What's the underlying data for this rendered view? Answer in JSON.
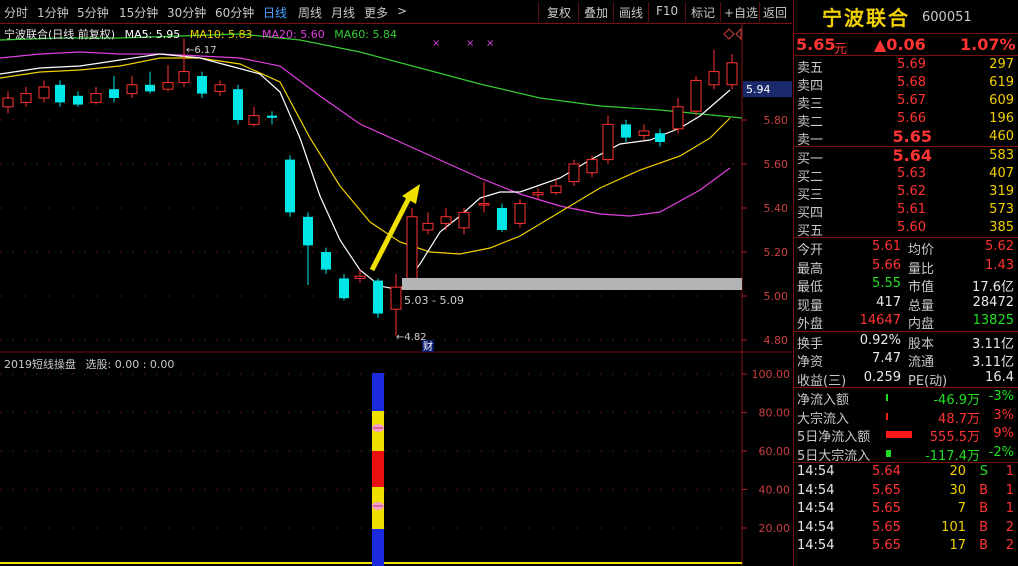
{
  "toolbar": {
    "period_tabs": [
      "分时",
      "1分钟",
      "5分钟",
      "15分钟",
      "30分钟",
      "60分钟",
      "日线",
      "周线",
      "月线",
      "更多"
    ],
    "more_arrow": ">",
    "active_tab": "日线",
    "actions": [
      "复权",
      "叠加",
      "画线",
      "F10",
      "标记",
      "+自选",
      "返回"
    ]
  },
  "chart": {
    "title": "宁波联合(日线 前复权)",
    "ma": [
      {
        "label": "MA5: 5.95",
        "color": "#ffffff"
      },
      {
        "label": "MA10: 5.83",
        "color": "#f0d000"
      },
      {
        "label": "MA20: 5.60",
        "color": "#e040e0"
      },
      {
        "label": "MA60: 5.84",
        "color": "#33cc33"
      }
    ],
    "price_axis": [
      "5.80",
      "5.60",
      "5.40",
      "5.20",
      "5.00",
      "4.80"
    ],
    "current_price_tag": "5.94",
    "high_mark": "6.17",
    "low_mark": "4.82",
    "range_label": "5.03 - 5.09",
    "finance_marker": "财",
    "sub_title": "2019短线操盘",
    "sub_select": "选股: 0.00 : 0.00",
    "sub_axis": [
      "100.00",
      "80.00",
      "60.00",
      "40.00",
      "20.00"
    ],
    "colors": {
      "up": "#ff3333",
      "down": "#00e5e5",
      "ma5": "#ffffff",
      "ma10": "#f0d000",
      "ma20": "#e040e0",
      "ma60": "#33cc33",
      "arrow": "#f0e000",
      "band": "#b4b4b4"
    }
  },
  "panel": {
    "name": "宁波联合",
    "code": "600051",
    "price": "5.65",
    "price_unit": "元",
    "change": "▲0.06",
    "change_pct": "1.07%",
    "asks": [
      {
        "label": "卖五",
        "price": "5.69",
        "vol": "297"
      },
      {
        "label": "卖四",
        "price": "5.68",
        "vol": "619"
      },
      {
        "label": "卖三",
        "price": "5.67",
        "vol": "609"
      },
      {
        "label": "卖二",
        "price": "5.66",
        "vol": "196"
      },
      {
        "label": "卖一",
        "price": "5.65",
        "vol": "460"
      }
    ],
    "bids": [
      {
        "label": "买一",
        "price": "5.64",
        "vol": "583"
      },
      {
        "label": "买二",
        "price": "5.63",
        "vol": "407"
      },
      {
        "label": "买三",
        "price": "5.62",
        "vol": "319"
      },
      {
        "label": "买四",
        "price": "5.61",
        "vol": "573"
      },
      {
        "label": "买五",
        "price": "5.60",
        "vol": "385"
      }
    ],
    "stats": [
      {
        "l1": "今开",
        "v1": "5.61",
        "c1": "red",
        "l2": "均价",
        "v2": "5.62",
        "c2": "red"
      },
      {
        "l1": "最高",
        "v1": "5.66",
        "c1": "red",
        "l2": "量比",
        "v2": "1.43",
        "c2": "red"
      },
      {
        "l1": "最低",
        "v1": "5.55",
        "c1": "green",
        "l2": "市值",
        "v2": "17.6亿",
        "c2": "white"
      },
      {
        "l1": "现量",
        "v1": "417",
        "c1": "white",
        "l2": "总量",
        "v2": "28472",
        "c2": "white"
      },
      {
        "l1": "外盘",
        "v1": "14647",
        "c1": "red",
        "l2": "内盘",
        "v2": "13825",
        "c2": "green"
      }
    ],
    "fund": [
      {
        "l1": "换手",
        "v1": "0.92%",
        "l2": "股本",
        "v2": "3.11亿"
      },
      {
        "l1": "净资",
        "v1": "7.47",
        "l2": "流通",
        "v2": "3.11亿"
      },
      {
        "l1": "收益(三)",
        "v1": "0.259",
        "l2": "PE(动)",
        "v2": "16.4"
      }
    ],
    "flows": [
      {
        "label": "净流入额",
        "value": "-46.9万",
        "pct": "-3%",
        "vc": "green",
        "pc": "green",
        "bar": "green",
        "bar_w": 0.06
      },
      {
        "label": "大宗流入",
        "value": "48.7万",
        "pct": "3%",
        "vc": "red",
        "pc": "red",
        "bar": "red",
        "bar_w": 0.06
      },
      {
        "label": "5日净流入额",
        "value": "555.5万",
        "pct": "9%",
        "vc": "red",
        "pc": "red",
        "bar": "red",
        "bar_w": 1.0
      },
      {
        "label": "5日大宗流入",
        "value": "-117.4万",
        "pct": "-2%",
        "vc": "green",
        "pc": "green",
        "bar": "green",
        "bar_w": 0.2
      }
    ],
    "ticks": [
      {
        "time": "14:54",
        "price": "5.64",
        "vol": "20",
        "bs": "S",
        "n": "1",
        "bsc": "green"
      },
      {
        "time": "14:54",
        "price": "5.65",
        "vol": "30",
        "bs": "B",
        "n": "1",
        "bsc": "red"
      },
      {
        "time": "14:54",
        "price": "5.65",
        "vol": "7",
        "bs": "B",
        "n": "1",
        "bsc": "red"
      },
      {
        "time": "14:54",
        "price": "5.65",
        "vol": "101",
        "bs": "B",
        "n": "2",
        "bsc": "red"
      },
      {
        "time": "14:54",
        "price": "5.65",
        "vol": "17",
        "bs": "B",
        "n": "2",
        "bsc": "red"
      }
    ]
  }
}
